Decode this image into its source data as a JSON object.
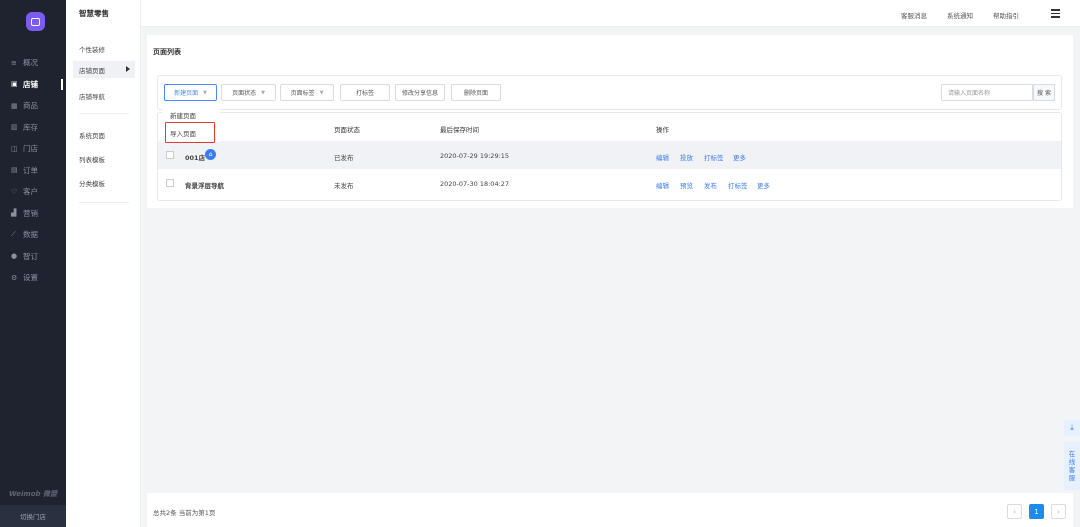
{
  "nav": {
    "items": [
      {
        "icon": "bars-icon",
        "glyph": "≡",
        "label": "概况"
      },
      {
        "icon": "store-icon",
        "glyph": "▣",
        "label": "店铺"
      },
      {
        "icon": "goods-icon",
        "glyph": "▦",
        "label": "商品"
      },
      {
        "icon": "inventory-icon",
        "glyph": "▥",
        "label": "库存"
      },
      {
        "icon": "shop-icon",
        "glyph": "◫",
        "label": "门店"
      },
      {
        "icon": "order-icon",
        "glyph": "▤",
        "label": "订单"
      },
      {
        "icon": "customer-icon",
        "glyph": "♡",
        "label": "客户"
      },
      {
        "icon": "marketing-icon",
        "glyph": "▟",
        "label": "营销"
      },
      {
        "icon": "data-icon",
        "glyph": "⟋",
        "label": "数据"
      },
      {
        "icon": "ordering-icon",
        "glyph": "●",
        "label": "智订"
      },
      {
        "icon": "settings-icon",
        "glyph": "⚙",
        "label": "设置"
      }
    ],
    "active_index": 1,
    "brand": "Weimob 微盟",
    "switch_store": "切换门店"
  },
  "sub": {
    "title": "智慧零售",
    "group1": [
      "个性装修",
      "店铺页面",
      "店铺导航"
    ],
    "group2": [
      "系统页面",
      "列表模板",
      "分类模板"
    ]
  },
  "topbar": {
    "links": [
      "客服消息",
      "系统通知",
      "帮助指引"
    ]
  },
  "panel": {
    "title": "页面列表",
    "toolbar": {
      "new_page": "新建页面",
      "status_filter": "页面状态",
      "tag_filter": "页面标签",
      "tag_btn": "打标签",
      "share_btn": "修改分享信息",
      "delete_btn": "删除页面",
      "search_placeholder": "请输入页面名称",
      "search_btn": "搜 索"
    },
    "columns": [
      "页面状态",
      "最后保存时间",
      "操作"
    ],
    "rows": [
      {
        "name": "001店",
        "status": "已发布",
        "saved": "2020-07-29 19:29:15",
        "ops": [
          "编辑",
          "投放",
          "打标签",
          "更多"
        ]
      },
      {
        "name": "背景浮层导航",
        "status": "未发布",
        "saved": "2020-07-30 18:04:27",
        "ops": [
          "编辑",
          "预览",
          "发布",
          "打标签",
          "更多"
        ]
      }
    ],
    "menu": [
      "新建页面",
      "导入页面"
    ]
  },
  "footer": {
    "summary": "总共2条 当前为第1页",
    "prev": "‹",
    "page": "1",
    "next": "›"
  },
  "float": {
    "download": "⤓",
    "service": "在线客服"
  }
}
